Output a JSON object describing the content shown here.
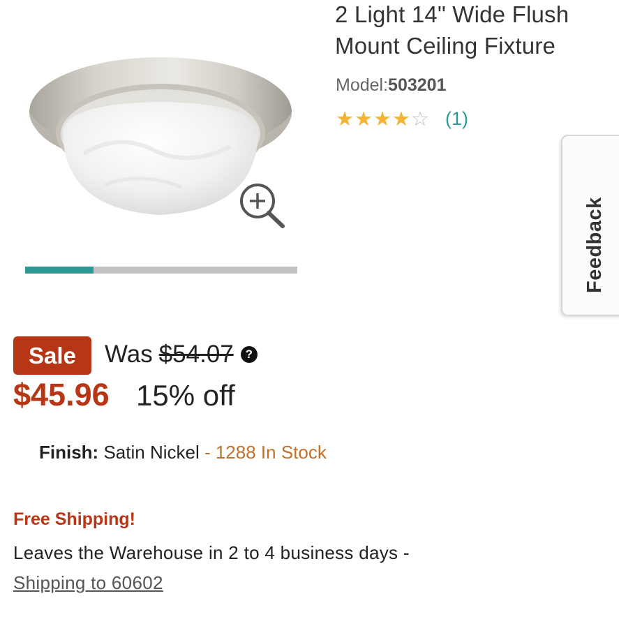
{
  "product": {
    "title": "2 Light 14\" Wide Flush Mount Ceiling Fixture",
    "model_label": "Model:",
    "model_number": "503201",
    "rating_stars": 4,
    "rating_max": 5,
    "review_count": "(1)"
  },
  "gallery": {
    "progress": 0.25,
    "image_icon": "ceiling-light-photo",
    "zoom_icon": "zoom-in-icon"
  },
  "feedback": {
    "label": "Feedback"
  },
  "pricing": {
    "sale_label": "Sale",
    "was_label": "Was",
    "was_price": "$54.07",
    "help_glyph": "?",
    "price": "$45.96",
    "discount": "15% off"
  },
  "finish": {
    "label": "Finish:",
    "value": "Satin Nickel",
    "stock": "- 1288 In Stock"
  },
  "shipping": {
    "headline": "Free Shipping!",
    "detail": "Leaves the Warehouse in 2 to 4 business days -",
    "link": "Shipping to 60602"
  },
  "colors": {
    "accent_teal": "#2a9a93",
    "sale_red": "#b63616",
    "star_gold": "#f5b335",
    "stock_orange": "#c0722a"
  }
}
